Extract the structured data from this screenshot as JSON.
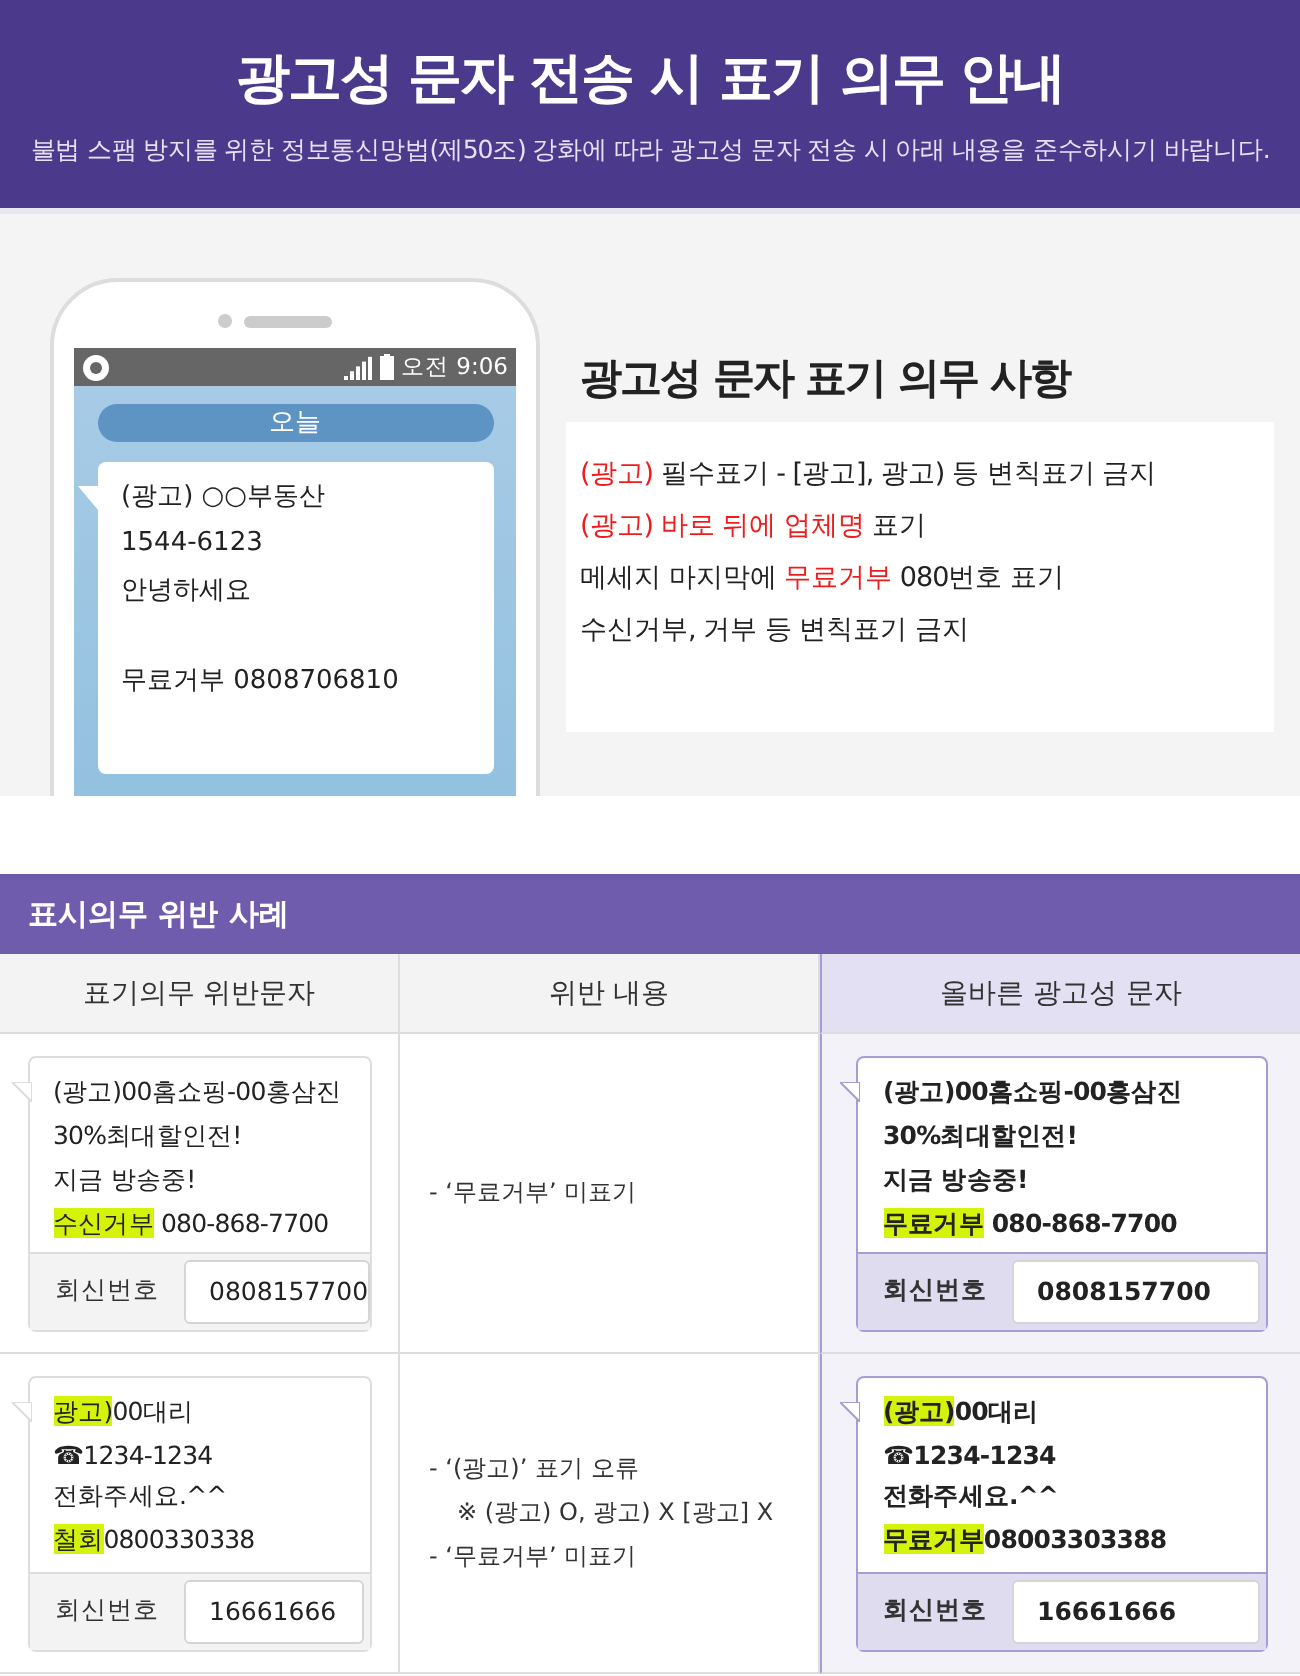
{
  "header": {
    "title": "광고성 문자 전송 시 표기 의무 안내",
    "subtitle": "불법 스팸 방지를 위한 정보통신망법(제50조) 강화에 따라 광고성 문자 전송 시 아래 내용을 준수하시기 바랍니다."
  },
  "phone": {
    "status_time": "오전 9:06",
    "date_label": "오늘",
    "message_lines": [
      "(광고) ○○부동산",
      "1544-6123",
      "안녕하세요"
    ],
    "opt_out_line": "무료거부 0808706810"
  },
  "rules": {
    "title": "광고성 문자 표기 의무 사항",
    "items": [
      {
        "segments": [
          {
            "text": "(광고)",
            "emphasis": true
          },
          {
            "text": " 필수표기 - [광고], 광고) 등 변칙표기 금지",
            "emphasis": false
          }
        ]
      },
      {
        "segments": [
          {
            "text": "(광고) 바로 뒤에 업체명",
            "emphasis": true
          },
          {
            "text": " 표기",
            "emphasis": false
          }
        ]
      },
      {
        "segments": [
          {
            "text": "메세지 마지막에 ",
            "emphasis": false
          },
          {
            "text": "무료거부",
            "emphasis": true
          },
          {
            "text": " 080번호 표기",
            "emphasis": false
          }
        ]
      },
      {
        "segments": [
          {
            "text": "수신거부, 거부 등 변칙표기 금지",
            "emphasis": false
          }
        ]
      }
    ]
  },
  "section_title": "표시의무 위반 사례",
  "table": {
    "columns": [
      {
        "label": "표기의무 위반문자",
        "highlighted": false
      },
      {
        "label": "위반 내용",
        "highlighted": false
      },
      {
        "label": "올바른 광고성 문자",
        "highlighted": true
      }
    ],
    "rows": [
      {
        "violation": {
          "kind": "wrong",
          "lines": [
            [
              {
                "text": "(광고)00홈쇼핑-00홍삼진",
                "highlight": false
              }
            ],
            [
              {
                "text": "30%최대할인전!",
                "highlight": false
              }
            ],
            [
              {
                "text": "지금 방송중!",
                "highlight": false
              }
            ],
            [
              {
                "text": "수신거부",
                "highlight": true
              },
              {
                "text": " 080-868-7700",
                "highlight": false
              }
            ]
          ],
          "reply_label": "회신번호",
          "reply_number": "0808157700"
        },
        "issues": [
          {
            "kind": "item",
            "text": "- ‘무료거부’ 미표기"
          }
        ],
        "correct": {
          "kind": "correct",
          "lines": [
            [
              {
                "text": "(광고)00홈쇼핑-00홍삼진",
                "highlight": false
              }
            ],
            [
              {
                "text": "30%최대할인전!",
                "highlight": false
              }
            ],
            [
              {
                "text": "지금 방송중!",
                "highlight": false
              }
            ],
            [
              {
                "text": "무료거부",
                "highlight": true
              },
              {
                "text": " 080-868-7700",
                "highlight": false
              }
            ]
          ],
          "reply_label": "회신번호",
          "reply_number": "0808157700"
        }
      },
      {
        "violation": {
          "kind": "wrong",
          "lines": [
            [
              {
                "text": "광고)",
                "highlight": true
              },
              {
                "text": "00대리",
                "highlight": false
              }
            ],
            [
              {
                "text": "☎1234-1234",
                "highlight": false
              }
            ],
            [
              {
                "text": "전화주세요.^^",
                "highlight": false
              }
            ],
            [
              {
                "text": "철회",
                "highlight": true
              },
              {
                "text": "0800330338",
                "highlight": false
              }
            ]
          ],
          "reply_label": "회신번호",
          "reply_number": "16661666"
        },
        "issues": [
          {
            "kind": "item",
            "text": "- ‘(광고)’ 표기 오류"
          },
          {
            "kind": "note",
            "text": "※ (광고) O, 광고) X [광고] X"
          },
          {
            "kind": "item",
            "text": "- ‘무료거부’ 미표기"
          }
        ],
        "correct": {
          "kind": "correct",
          "lines": [
            [
              {
                "text": "(광고)",
                "highlight": true
              },
              {
                "text": "00대리",
                "highlight": false
              }
            ],
            [
              {
                "text": "☎1234-1234",
                "highlight": false
              }
            ],
            [
              {
                "text": "전화주세요.^^",
                "highlight": false
              }
            ],
            [
              {
                "text": "무료거부",
                "highlight": true
              },
              {
                "text": "08003303388",
                "highlight": false
              }
            ]
          ],
          "reply_label": "회신번호",
          "reply_number": "16661666"
        }
      }
    ]
  }
}
